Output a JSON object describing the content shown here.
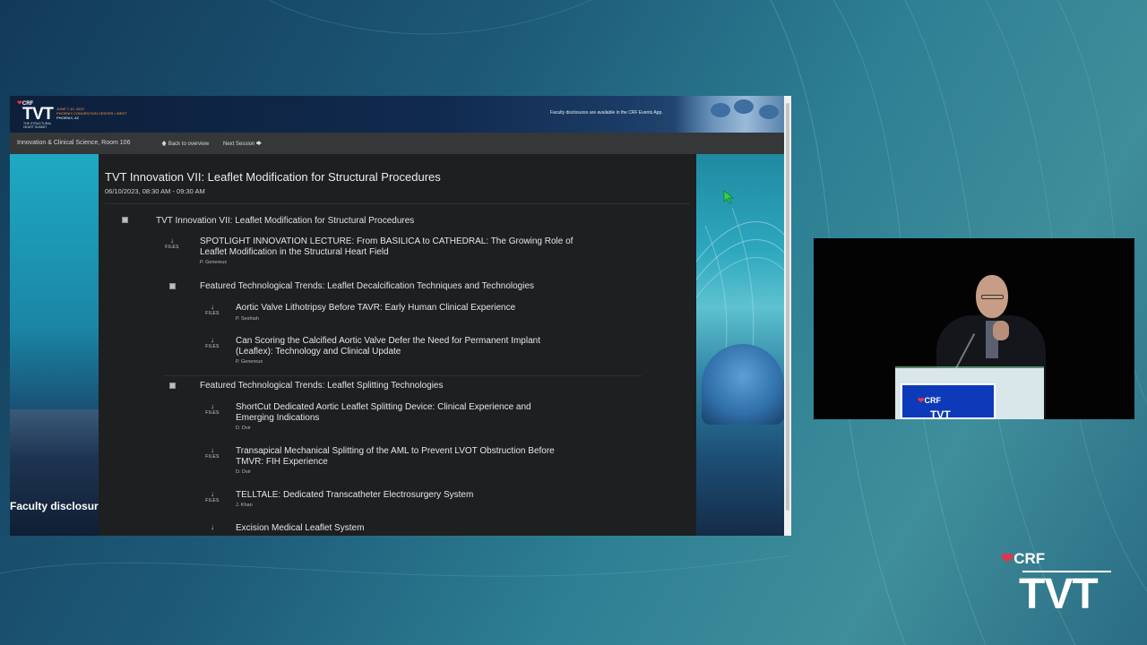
{
  "header": {
    "logo_crf": "CRF",
    "logo_tvt": "TVT",
    "logo_sub": "THE STRUCTURAL HEART SUMMIT",
    "event_dates": "JUNE 7-10, 2023",
    "event_venue": "PHOENIX CONVENTION CENTER • WEST",
    "event_city": "PHOENIX, AZ",
    "disclosure": "Faculty disclosures are available in the CRF Events App."
  },
  "nav": {
    "room": "Innovation & Clinical Science, Room 106",
    "back": "🡅 Back to overview",
    "next": "Next Session 🡆"
  },
  "session": {
    "title": "TVT Innovation VII: Leaflet Modification for Structural Procedures",
    "datetime": "06/10/2023, 08:30 AM - 09:30 AM"
  },
  "agenda": {
    "top_group": "TVT Innovation VII: Leaflet Modification for Structural Procedures",
    "files_arrow": "↓",
    "files_label": "FILES",
    "talks": [
      {
        "title": "SPOTLIGHT INNOVATION LECTURE: From BASILICA to CATHEDRAL: The Growing Role of Leaflet Modification in the Structural Heart Field",
        "speaker": "P. Genereux"
      },
      {
        "title": "Aortic Valve Lithotripsy Before TAVR: Early Human Clinical Experience",
        "speaker": "P. Seshiah"
      },
      {
        "title": "Can Scoring the Calcified Aortic Valve Defer the Need for Permanent Implant (Leaflex): Technology and Clinical Update",
        "speaker": "P. Genereux"
      },
      {
        "title": "ShortCut Dedicated Aortic Leaflet Splitting Device: Clinical Experience and Emerging Indications",
        "speaker": "D. Dvir"
      },
      {
        "title": "Transapical Mechanical Splitting of the AML to Prevent LVOT Obstruction Before TMVR: FIH Experience",
        "speaker": "D. Dvir"
      },
      {
        "title": "TELLTALE: Dedicated Transcatheter Electrosurgery System",
        "speaker": "J. Khan"
      },
      {
        "title": "Excision Medical Leaflet System",
        "speaker": ""
      }
    ],
    "groups": [
      "Featured Technological Trends: Leaflet Decalcification Techniques and Technologies",
      "Featured Technological Trends: Leaflet Splitting Technologies"
    ]
  },
  "side_banner": {
    "text": "Faculty disclosure"
  },
  "podium": {
    "crf": "CRF",
    "tvt": "TVT"
  },
  "brand": {
    "crf": "CRF",
    "tvt": "TVT"
  },
  "colors": {
    "accent_red": "#e0354a",
    "orange": "#ff9a3c",
    "header_navy": "#0d1f3a"
  }
}
